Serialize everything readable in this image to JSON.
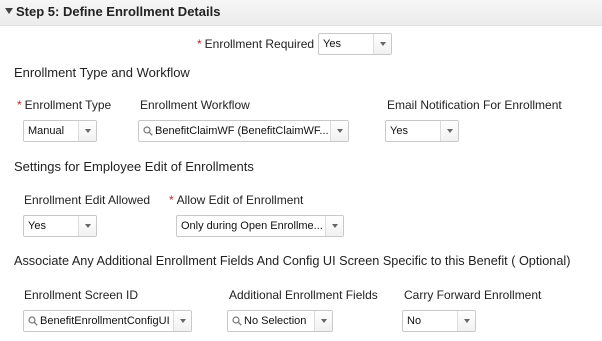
{
  "section": {
    "title": "Step 5: Define Enrollment Details"
  },
  "enrollment_required": {
    "label": "Enrollment Required",
    "value": "Yes",
    "required": "*"
  },
  "group_type_workflow": {
    "title": "Enrollment Type and Workflow",
    "enrollment_type": {
      "label": "Enrollment Type",
      "value": "Manual",
      "required": "*"
    },
    "enrollment_workflow": {
      "label": "Enrollment Workflow",
      "value": "BenefitClaimWF (BenefitClaimWF..."
    },
    "email_notification": {
      "label": "Email Notification For Enrollment",
      "value": "Yes"
    }
  },
  "group_employee_edit": {
    "title": "Settings for Employee Edit of Enrollments",
    "edit_allowed": {
      "label": "Enrollment Edit Allowed",
      "value": "Yes"
    },
    "allow_edit": {
      "label": "Allow Edit of Enrollment",
      "value": "Only during Open Enrollme...",
      "required": "*"
    }
  },
  "group_additional": {
    "title": "Associate Any Additional Enrollment Fields And Config UI Screen Specific to this Benefit ( Optional)",
    "screen_id": {
      "label": "Enrollment Screen ID",
      "value": "BenefitEnrollmentConfigUI"
    },
    "additional_fields": {
      "label": "Additional Enrollment Fields",
      "value": "No Selection"
    },
    "carry_forward": {
      "label": "Carry Forward Enrollment",
      "value": "No"
    }
  },
  "colors": {
    "required_star": "#d11f1f",
    "header_bg": "#f0f0f0"
  },
  "icons": {
    "collapse": "collapse-triangle-icon",
    "lookup": "magnifier-icon",
    "dropdown": "chevron-down-icon"
  }
}
